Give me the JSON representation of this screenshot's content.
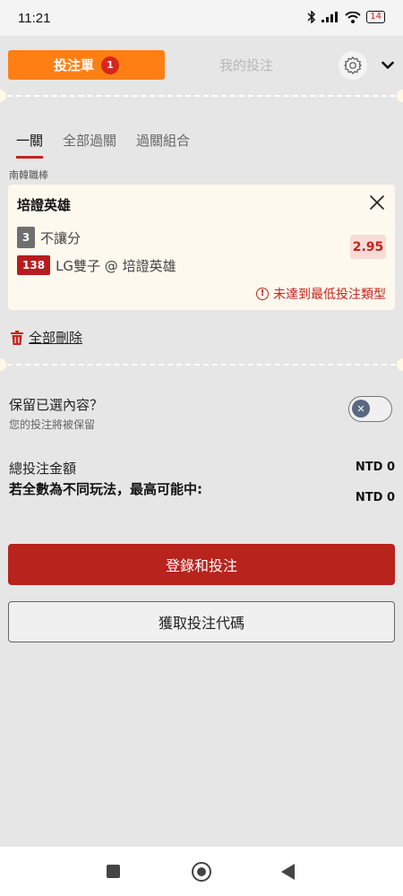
{
  "status_bar": {
    "time": "11:21",
    "battery": "14"
  },
  "header": {
    "betslip_tab": "投注單",
    "betslip_count": "1",
    "mybets_tab": "我的投注"
  },
  "bet_types": [
    "一關",
    "全部過關",
    "過關組合"
  ],
  "league": "南韓職棒",
  "selection": {
    "team": "培證英雄",
    "handicap_badge": "3",
    "market": "不讓分",
    "match_id": "138",
    "match": "LG雙子 @ 培證英雄",
    "odds": "2.95",
    "warning": "未達到最低投注類型"
  },
  "delete_all": "全部刪除",
  "keep_selection": {
    "title": "保留已選內容？",
    "subtitle": "您的投注將被保留"
  },
  "summary": {
    "total_label": "總投注金額",
    "total_value": "NTD 0",
    "win_label": "若全數為不同玩法，最高可能中:",
    "win_value": "NTD 0"
  },
  "actions": {
    "login_bet": "登錄和投注",
    "get_code": "獲取投注代碼"
  },
  "colors": {
    "accent_orange": "#ff7f14",
    "brand_red": "#b8231c",
    "warning_red": "#c8231c"
  }
}
